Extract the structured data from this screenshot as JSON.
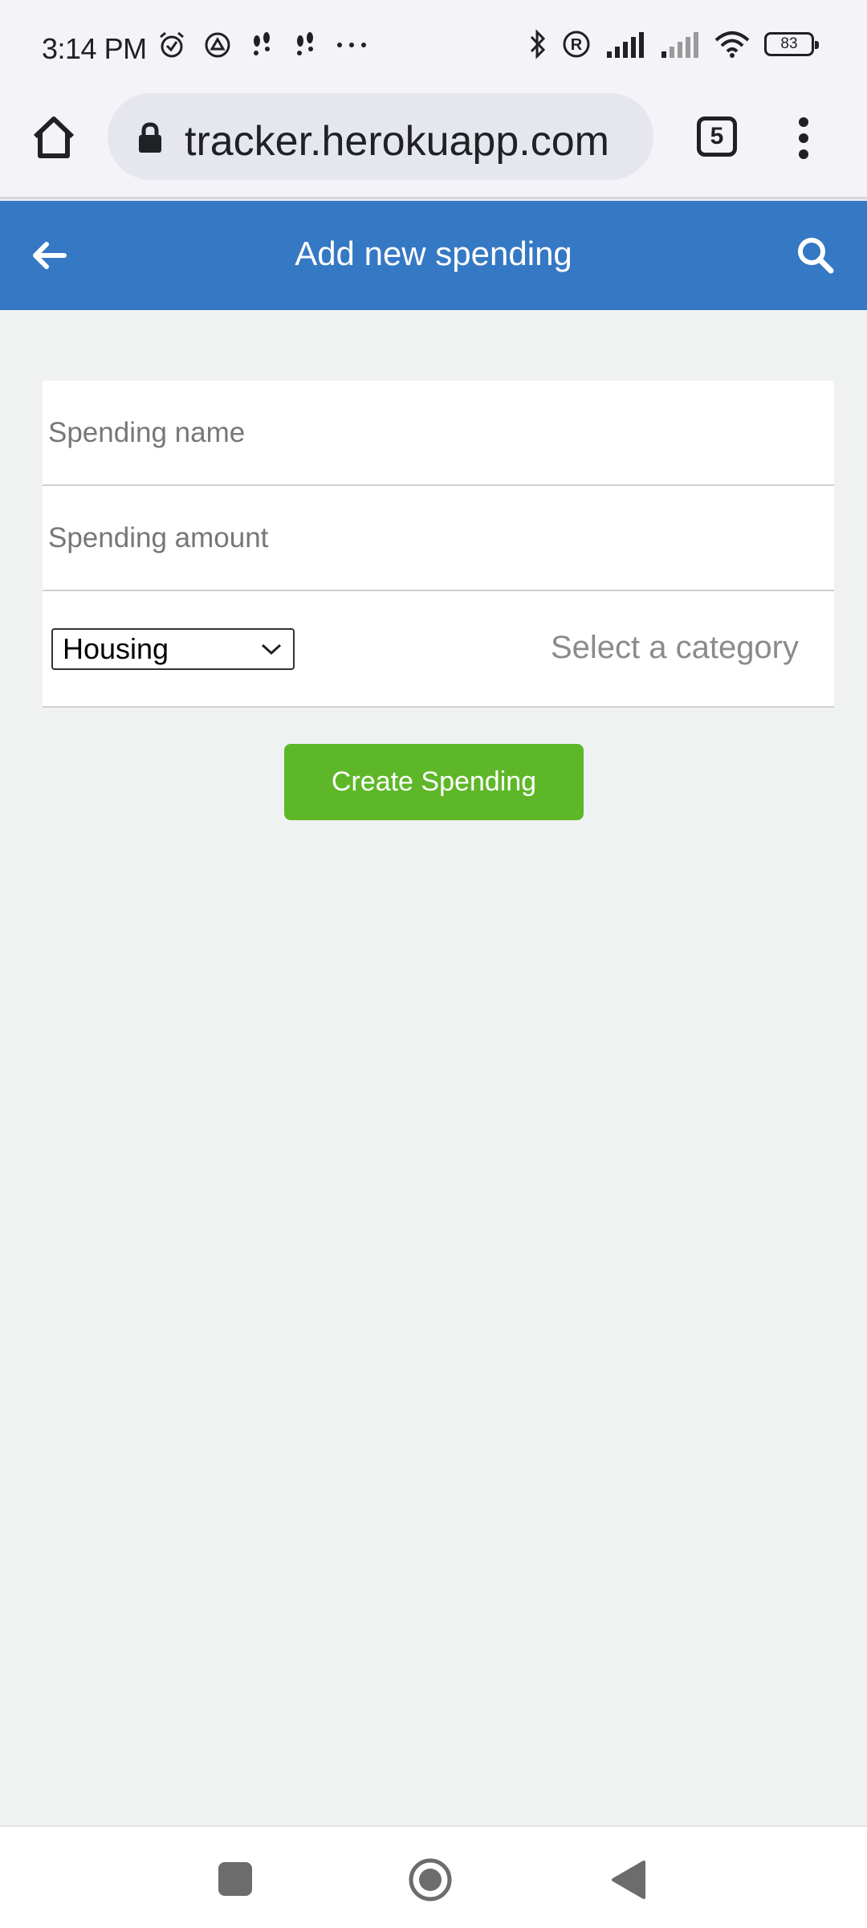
{
  "status_bar": {
    "time": "3:14 PM",
    "battery": "83"
  },
  "browser": {
    "url": "tracker.herokuapp.com",
    "tab_count": "5"
  },
  "app_bar": {
    "title": "Add new spending"
  },
  "form": {
    "name_placeholder": "Spending name",
    "amount_placeholder": "Spending amount",
    "category_selected": "Housing",
    "category_label": "Select a category",
    "submit_label": "Create Spending"
  },
  "colors": {
    "app_bar": "#3578c4",
    "submit_button": "#5eb728",
    "page_background": "#f0f2f1"
  }
}
